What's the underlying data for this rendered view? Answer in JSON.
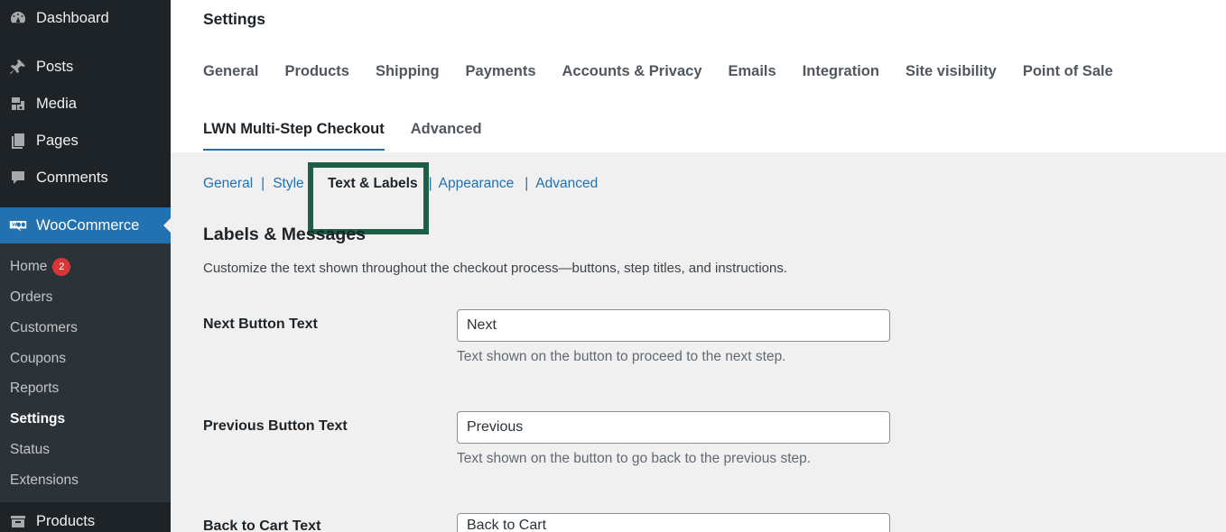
{
  "sidebar": {
    "items": [
      {
        "label": "Dashboard",
        "icon": "dashboard-icon"
      },
      {
        "label": "Posts",
        "icon": "pin-icon"
      },
      {
        "label": "Media",
        "icon": "media-icon"
      },
      {
        "label": "Pages",
        "icon": "pages-icon"
      },
      {
        "label": "Comments",
        "icon": "comments-icon"
      },
      {
        "label": "WooCommerce",
        "icon": "woocommerce-icon"
      }
    ],
    "woo_submenu": [
      {
        "label": "Home",
        "badge": "2"
      },
      {
        "label": "Orders"
      },
      {
        "label": "Customers"
      },
      {
        "label": "Coupons"
      },
      {
        "label": "Reports"
      },
      {
        "label": "Settings"
      },
      {
        "label": "Status"
      },
      {
        "label": "Extensions"
      }
    ],
    "products_label": "Products"
  },
  "header": {
    "title": "Settings",
    "tabs": [
      "General",
      "Products",
      "Shipping",
      "Payments",
      "Accounts & Privacy",
      "Emails",
      "Integration",
      "Site visibility",
      "Point of Sale"
    ],
    "tabs_row2": [
      "LWN Multi-Step Checkout",
      "Advanced"
    ]
  },
  "subnav": {
    "items": [
      "General",
      "Style",
      "Text & Labels",
      "Appearance",
      "Advanced"
    ],
    "current": "Text & Labels"
  },
  "section": {
    "title": "Labels & Messages",
    "description": "Customize the text shown throughout the checkout process—buttons, step titles, and instructions."
  },
  "fields": [
    {
      "label": "Next Button Text",
      "value": "Next",
      "description": "Text shown on the button to proceed to the next step."
    },
    {
      "label": "Previous Button Text",
      "value": "Previous",
      "description": "Text shown on the button to go back to the previous step."
    },
    {
      "label": "Back to Cart Text",
      "value": "Back to Cart"
    }
  ],
  "colors": {
    "sidebar_bg": "#1d2327",
    "accent": "#2271b1",
    "highlight_box": "#1f5e45",
    "badge": "#d63638"
  }
}
